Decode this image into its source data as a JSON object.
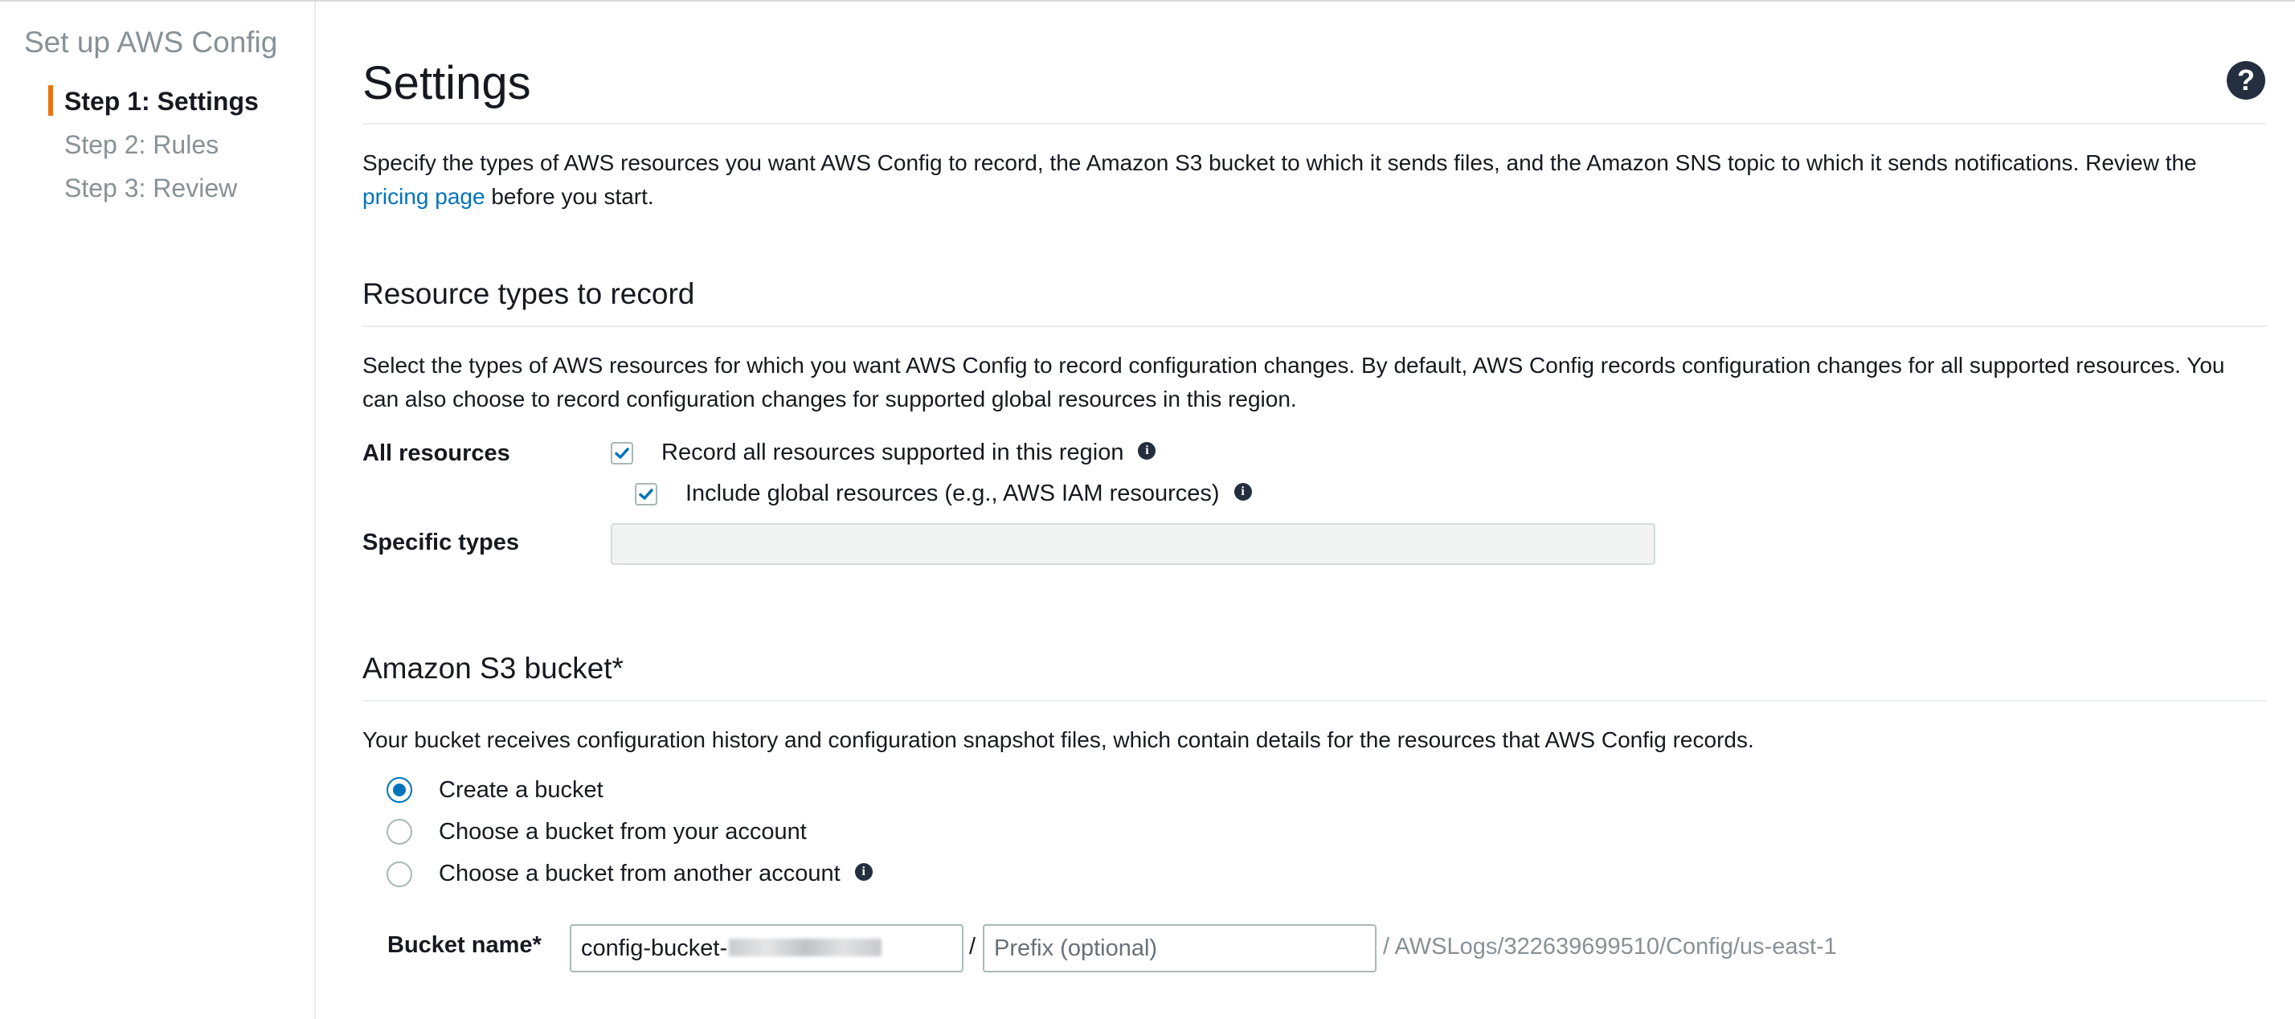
{
  "sidebar": {
    "title": "Set up AWS Config",
    "steps": [
      {
        "label": "Step 1: Settings"
      },
      {
        "label": "Step 2: Rules"
      },
      {
        "label": "Step 3: Review"
      }
    ]
  },
  "header": {
    "title": "Settings",
    "help_icon": "?"
  },
  "intro": {
    "text_before": "Specify the types of AWS resources you want AWS Config to record, the Amazon S3 bucket to which it sends files, and the Amazon SNS topic to which it sends notifications. Review the",
    "link": "pricing page",
    "text_after": "before you start."
  },
  "resource_types": {
    "title": "Resource types to record",
    "description": "Select the types of AWS resources for which you want AWS Config to record configuration changes. By default, AWS Config records configuration changes for all supported resources. You can also choose to record configuration changes for supported global resources in this region.",
    "all_resources_label": "All resources",
    "record_all_label": "Record all resources supported in this region",
    "include_global_label": "Include global resources (e.g., AWS IAM resources)",
    "specific_types_label": "Specific types",
    "info_icon": "i"
  },
  "s3_bucket": {
    "title": "Amazon S3 bucket*",
    "description": "Your bucket receives configuration history and configuration snapshot files, which contain details for the resources that AWS Config records.",
    "options": [
      {
        "label": "Create a bucket"
      },
      {
        "label": "Choose a bucket from your account"
      },
      {
        "label": "Choose a bucket from another account"
      }
    ],
    "bucket_name_label": "Bucket name*",
    "bucket_name_value": "config-bucket-",
    "prefix_placeholder": "Prefix (optional)",
    "separator": "/",
    "path_suffix": "/ AWSLogs/322639699510/Config/us-east-1"
  },
  "colors": {
    "accent": "#ec7211",
    "link": "#0073bb",
    "checkbox_check": "#0073bb"
  }
}
